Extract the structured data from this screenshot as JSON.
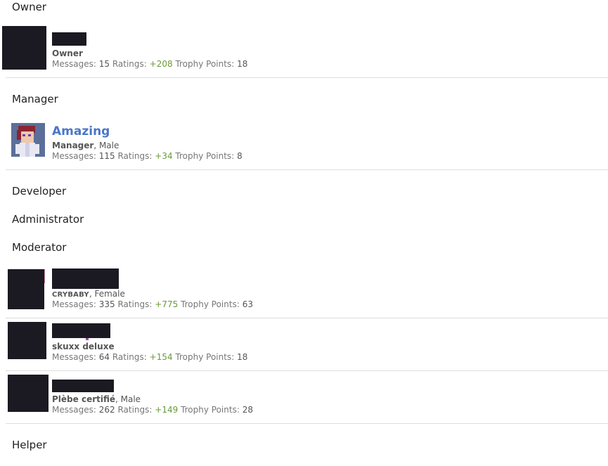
{
  "groups": {
    "owner": "Owner",
    "manager": "Manager",
    "developer": "Developer",
    "administrator": "Administrator",
    "moderator": "Moderator",
    "helper": "Helper"
  },
  "labels": {
    "messages": "Messages:",
    "ratings": "Ratings:",
    "trophy_points": "Trophy Points:"
  },
  "members": [
    {
      "name": "",
      "title": "Owner",
      "gender": "",
      "messages": "15",
      "ratings": "+208",
      "trophy_points": "18"
    },
    {
      "name": "Amazing",
      "title": "Manager",
      "gender": ", Male",
      "messages": "115",
      "ratings": "+34",
      "trophy_points": "8"
    },
    {
      "name": "",
      "title": "CRYBABY",
      "gender": ", Female",
      "messages": "335",
      "ratings": "+775",
      "trophy_points": "63"
    },
    {
      "name": "",
      "title": "skuxx deluxe",
      "gender": "",
      "messages": "64",
      "ratings": "+154",
      "trophy_points": "18"
    },
    {
      "name": "",
      "title": "Plèbe certifié",
      "gender": ", Male",
      "messages": "262",
      "ratings": "+149",
      "trophy_points": "28"
    }
  ],
  "colors": {
    "username": "#4a76c8",
    "rating_positive": "#6a9a3a",
    "redaction": "#1b1922"
  }
}
